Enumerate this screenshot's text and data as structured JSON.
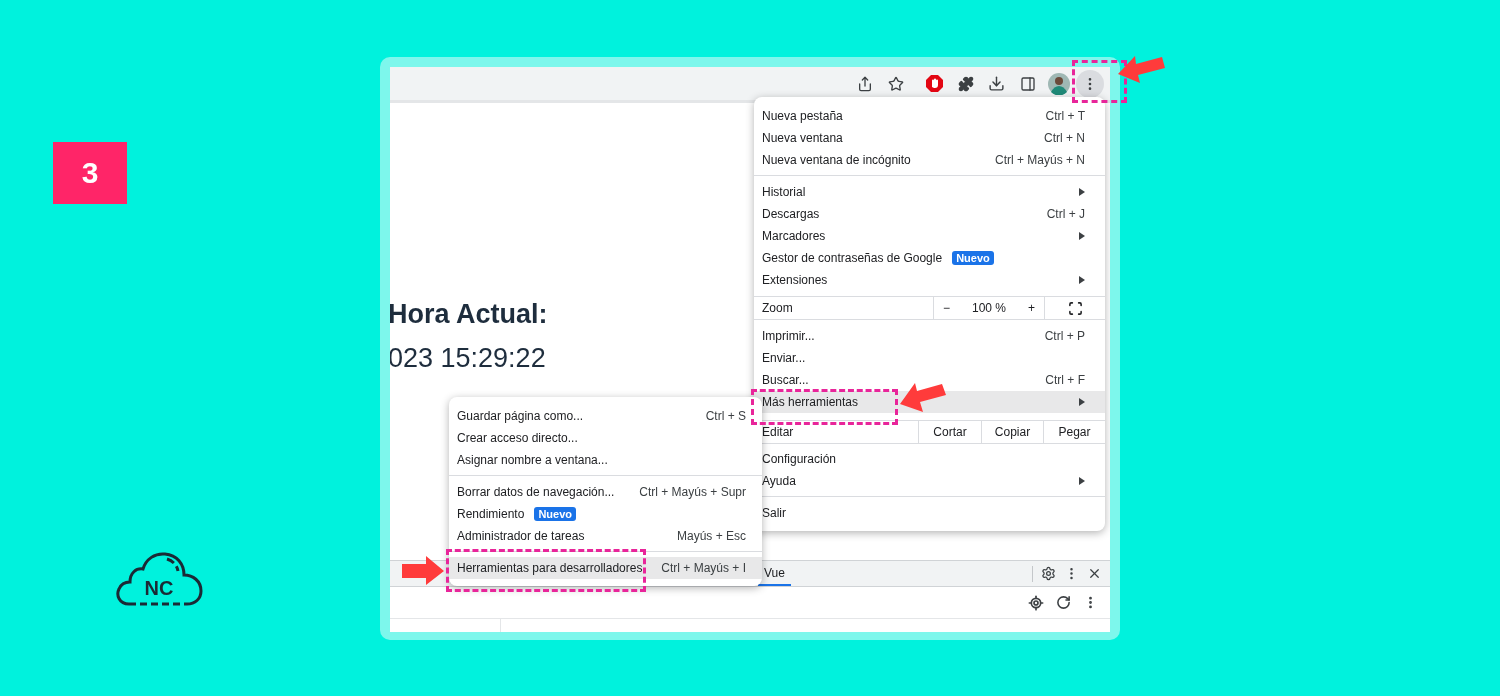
{
  "step_badge": "3",
  "logo": {
    "text": "NC"
  },
  "browser": {
    "page": {
      "heading": "Hora Actual:",
      "time": "023 15:29:22"
    },
    "menu": {
      "items": [
        {
          "kind": "item",
          "label": "Nueva pestaña",
          "shortcut": "Ctrl + T",
          "submenu": false,
          "highlighted": false
        },
        {
          "kind": "item",
          "label": "Nueva ventana",
          "shortcut": "Ctrl + N",
          "submenu": false,
          "highlighted": false
        },
        {
          "kind": "item",
          "label": "Nueva ventana de incógnito",
          "shortcut": "Ctrl + Mayús + N",
          "submenu": false,
          "highlighted": false
        },
        {
          "kind": "divider"
        },
        {
          "kind": "item",
          "label": "Historial",
          "submenu": true,
          "highlighted": false
        },
        {
          "kind": "item",
          "label": "Descargas",
          "shortcut": "Ctrl + J",
          "submenu": false,
          "highlighted": false
        },
        {
          "kind": "item",
          "label": "Marcadores",
          "submenu": true,
          "highlighted": false
        },
        {
          "kind": "item",
          "label": "Gestor de contraseñas de Google",
          "badge": "Nuevo",
          "submenu": false,
          "highlighted": false
        },
        {
          "kind": "item",
          "label": "Extensiones",
          "submenu": true,
          "highlighted": false
        },
        {
          "kind": "zoom",
          "label": "Zoom",
          "minus": "−",
          "value": "100 %",
          "plus": "+"
        },
        {
          "kind": "item",
          "label": "Imprimir...",
          "shortcut": "Ctrl + P",
          "submenu": false,
          "highlighted": false
        },
        {
          "kind": "item",
          "label": "Enviar...",
          "submenu": false,
          "highlighted": false
        },
        {
          "kind": "item",
          "label": "Buscar...",
          "shortcut": "Ctrl + F",
          "submenu": false,
          "highlighted": false
        },
        {
          "kind": "item",
          "label": "Más herramientas",
          "submenu": true,
          "highlighted": true
        },
        {
          "kind": "edit",
          "label": "Editar",
          "actions": [
            "Cortar",
            "Copiar",
            "Pegar"
          ]
        },
        {
          "kind": "item",
          "label": "Configuración",
          "submenu": false,
          "highlighted": false
        },
        {
          "kind": "item",
          "label": "Ayuda",
          "submenu": true,
          "highlighted": false
        },
        {
          "kind": "divider"
        },
        {
          "kind": "item",
          "label": "Salir",
          "submenu": false,
          "highlighted": false
        }
      ]
    },
    "submenu": {
      "items": [
        {
          "kind": "item",
          "label": "Guardar página como...",
          "shortcut": "Ctrl + S",
          "submenu": false,
          "highlighted": false
        },
        {
          "kind": "item",
          "label": "Crear acceso directo...",
          "submenu": false,
          "highlighted": false
        },
        {
          "kind": "item",
          "label": "Asignar nombre a ventana...",
          "submenu": false,
          "highlighted": false
        },
        {
          "kind": "divider"
        },
        {
          "kind": "item",
          "label": "Borrar datos de navegación...",
          "shortcut": "Ctrl + Mayús + Supr",
          "submenu": false,
          "highlighted": false
        },
        {
          "kind": "item",
          "label": "Rendimiento",
          "badge": "Nuevo",
          "submenu": false,
          "highlighted": false
        },
        {
          "kind": "item",
          "label": "Administrador de tareas",
          "shortcut": "Mayús + Esc",
          "submenu": false,
          "highlighted": false
        },
        {
          "kind": "divider"
        },
        {
          "kind": "item",
          "label": "Herramientas para desarrolladores",
          "shortcut": "Ctrl + Mayús + I",
          "submenu": false,
          "highlighted": true
        }
      ]
    },
    "devtools": {
      "tabs": [
        {
          "label": "Vue",
          "selected": true
        }
      ]
    }
  }
}
